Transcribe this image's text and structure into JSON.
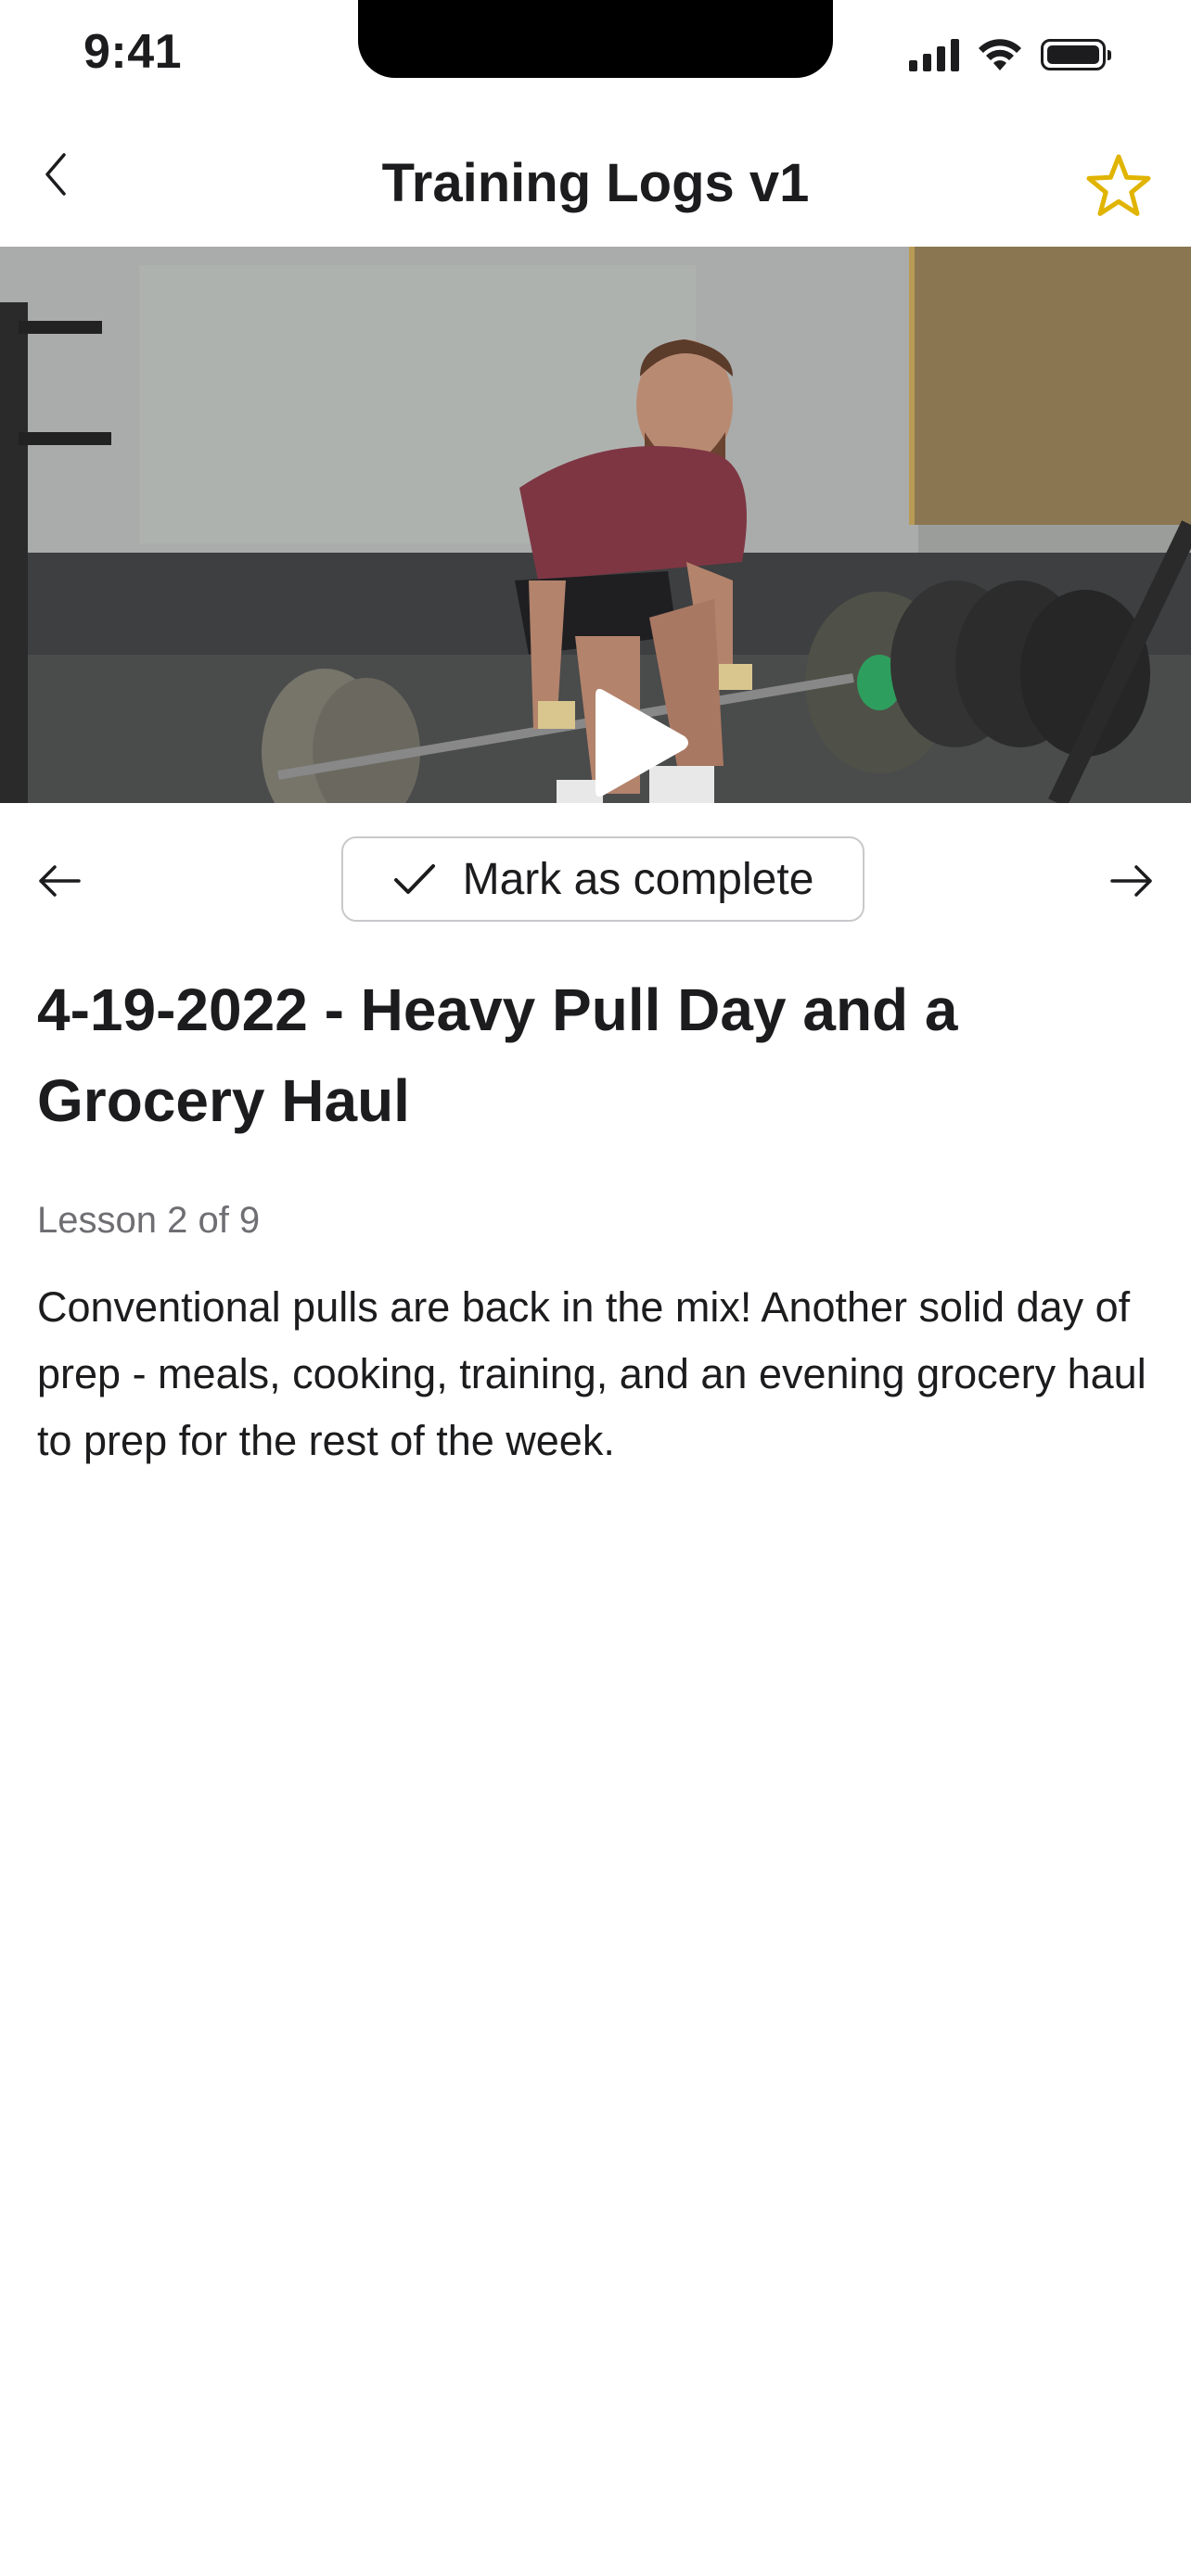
{
  "status_bar": {
    "time": "9:41",
    "icons": [
      "signal-icon",
      "wifi-icon",
      "battery-icon"
    ]
  },
  "nav": {
    "title": "Training Logs v1",
    "back_icon": "chevron-left-icon",
    "favorite_icon": "star-outline-icon"
  },
  "video": {
    "play_icon": "play-icon"
  },
  "actions": {
    "prev_icon": "arrow-left-icon",
    "next_icon": "arrow-right-icon",
    "complete_label": "Mark as complete",
    "check_icon": "checkmark-icon"
  },
  "lesson": {
    "title": "4-19-2022 - Heavy Pull Day and a Grocery Haul",
    "meta": "Lesson 2 of 9",
    "description": "Conventional pulls are back in the mix! Another solid day of prep - meals, cooking, training, and an evening grocery haul to prep for the rest of the week."
  },
  "colors": {
    "accent_star": "#e0b400",
    "text_primary": "#1c1c1e",
    "text_secondary": "#6e6e73",
    "border": "#c9c9cc"
  }
}
